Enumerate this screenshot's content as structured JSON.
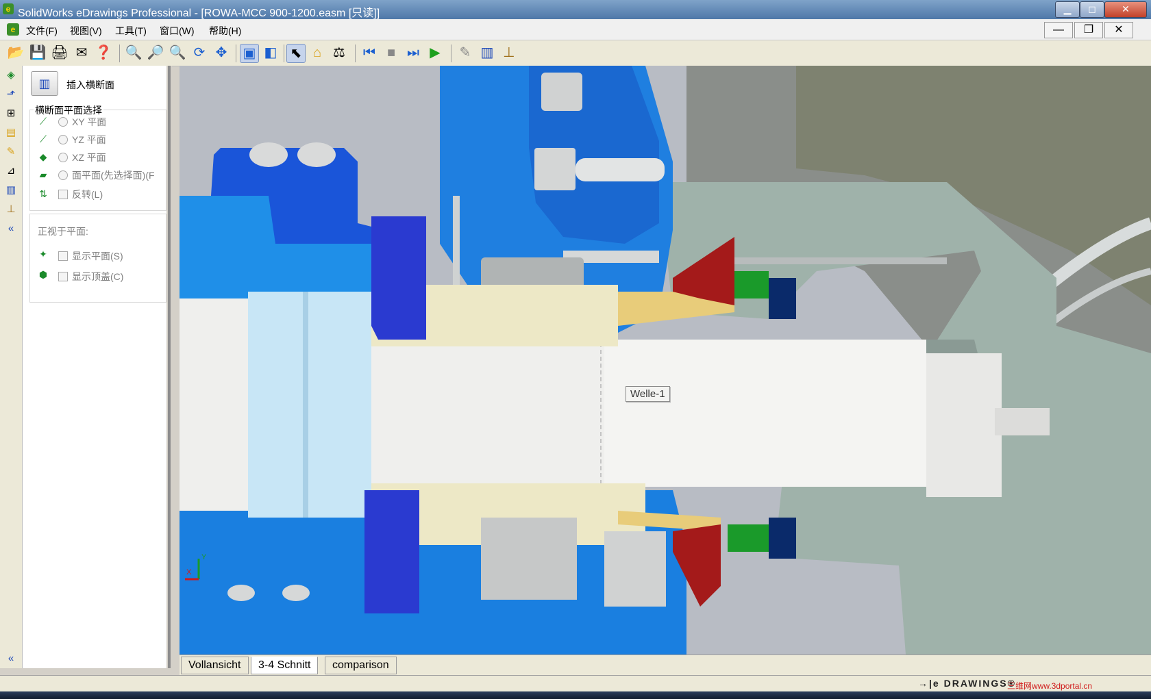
{
  "window": {
    "title": "SolidWorks eDrawings Professional - [ROWA-MCC 900-1200.easm [只读]]",
    "buttons": {
      "minimize": "▁",
      "maximize": "◻",
      "close": "✕"
    }
  },
  "menu": {
    "items": [
      "文件(F)",
      "视图(V)",
      "工具(T)",
      "窗口(W)",
      "帮助(H)"
    ],
    "mdi_buttons": {
      "minimize": "—",
      "restore": "❐",
      "close": "✕"
    }
  },
  "toolbar": {
    "icons": [
      "open-icon",
      "save-icon",
      "print-icon",
      "send-icon",
      "help-icon",
      "zoom-fit-icon",
      "zoom-area-icon",
      "zoom-icon",
      "rotate-icon",
      "pan-icon",
      "shaded-icon",
      "perspective-icon",
      "select-icon",
      "home-icon",
      "measure-icon",
      "first-frame-icon",
      "stop-icon",
      "last-frame-icon",
      "play-icon",
      "markup-icon",
      "section-icon",
      "stamp-icon"
    ]
  },
  "panel": {
    "header_label": "插入横断面",
    "group_label": "横断面平面选择",
    "planes": [
      {
        "label": "XY 平面"
      },
      {
        "label": "YZ 平面"
      },
      {
        "label": "XZ 平面"
      },
      {
        "label": "面平面(先选择面)(F"
      }
    ],
    "flip_label": "反转(L)",
    "view_normal_label": "正视于平面:",
    "show_plane_label": "显示平面(S)",
    "show_cap_label": "显示顶盖(C)"
  },
  "viewport": {
    "tooltip": "Welle-1",
    "triad": {
      "x": "X",
      "y": "Y"
    }
  },
  "tabs": [
    "Vollansicht",
    "3-4 Schnitt",
    "comparison"
  ],
  "selected_tab": "3-4 Schnitt",
  "status": {
    "logo": "→|e DRAWINGS®",
    "watermark": "三维网www.3dportal.cn"
  },
  "colors": {
    "blue_part": "#1a55d9",
    "light_blue_part": "#1f8fe8",
    "shaft": "#f2f2f0",
    "housing": "#9aa0a0",
    "seal_red": "#a41a1a",
    "seal_green": "#1a9a2a",
    "yellow_part": "#e8cc7a",
    "grey_teal": "#9ab0a8"
  }
}
